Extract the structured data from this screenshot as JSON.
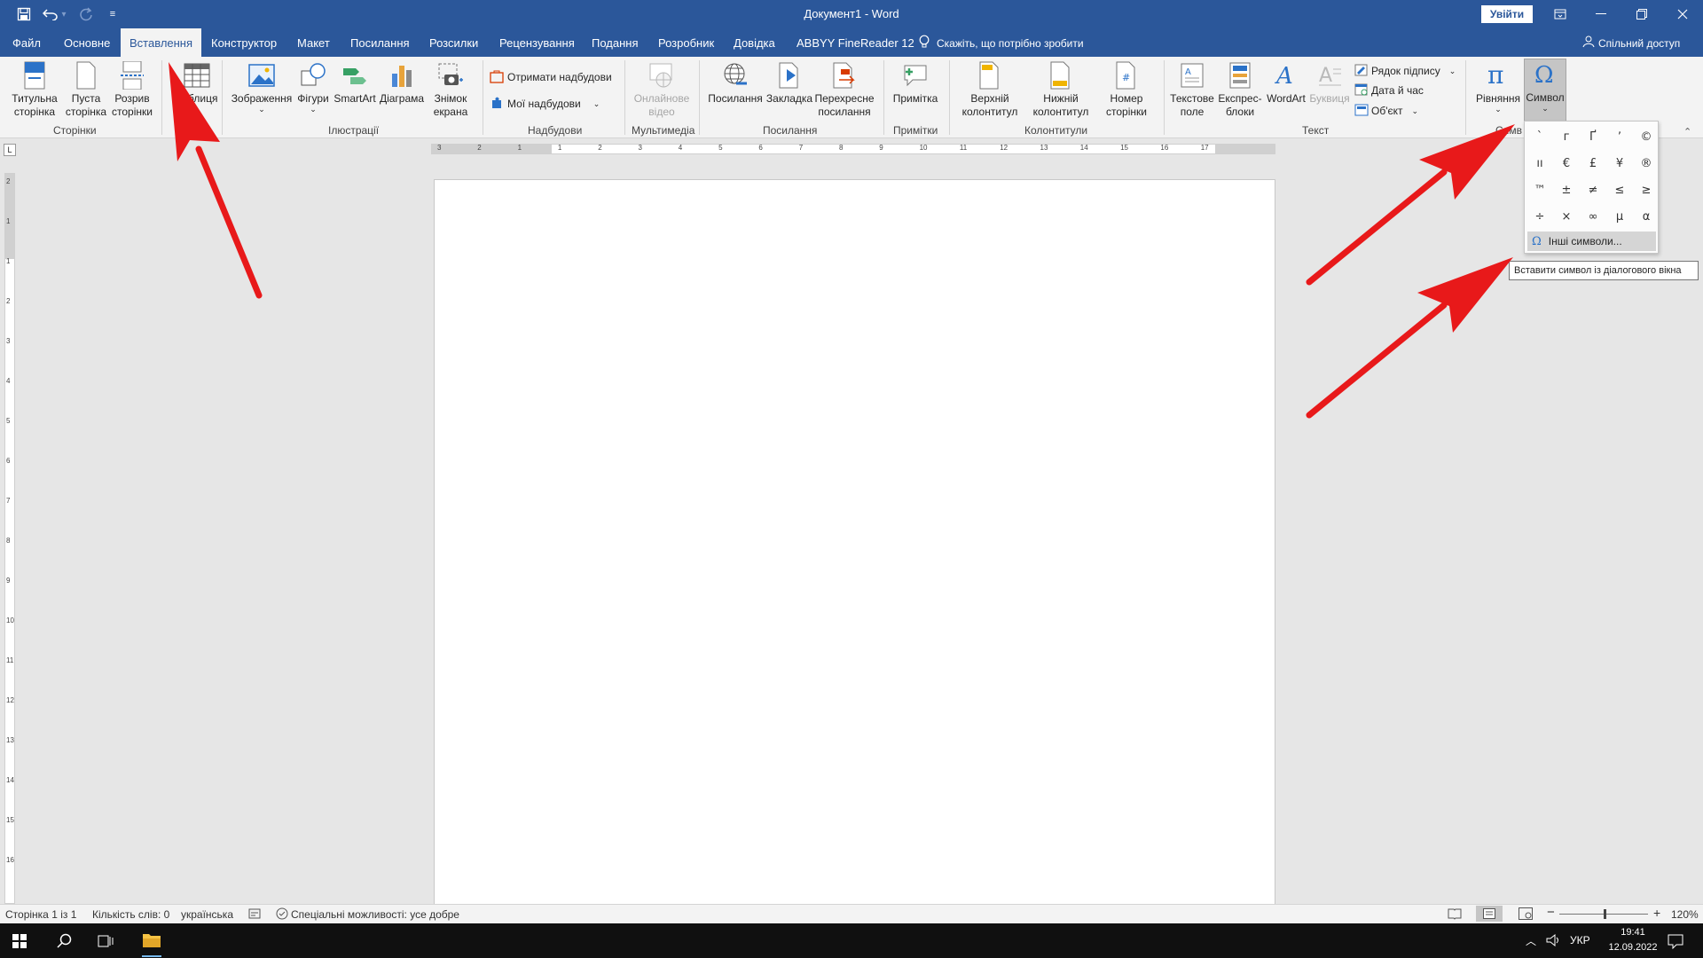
{
  "app": {
    "doc_title": "Документ1 - Word",
    "signin_label": "Увійти",
    "share_label": "Спільний доступ"
  },
  "qat": {
    "icons": [
      "save-icon",
      "undo-icon",
      "redo-icon",
      "customize-icon"
    ]
  },
  "tabs": [
    "Файл",
    "Основне",
    "Вставлення",
    "Конструктор",
    "Макет",
    "Посилання",
    "Розсилки",
    "Рецензування",
    "Подання",
    "Розробник",
    "Довідка",
    "ABBYY FineReader 12"
  ],
  "active_tab": "Вставлення",
  "tell_me": "Скажіть, що потрібно зробити",
  "ribbon": {
    "pages": {
      "label": "Сторінки",
      "cover": "Титульна сторінка",
      "blank": "Пуста сторінка",
      "break": "Розрив сторінки"
    },
    "table": {
      "label": "Таблиця"
    },
    "illustrations": {
      "label": "Ілюстрації",
      "pictures": "Зображення",
      "shapes": "Фігури",
      "smartart": "SmartArt",
      "chart": "Діаграма",
      "screenshot": "Знімок екрана"
    },
    "addins": {
      "label": "Надбудови",
      "get": "Отримати надбудови",
      "my": "Мої надбудови"
    },
    "media": {
      "label": "Мультимедіа",
      "online_video": "Онлайнове відео"
    },
    "links": {
      "label": "Посилання",
      "link": "Посилання",
      "bookmark": "Закладка",
      "crossref": "Перехресне посилання"
    },
    "comments": {
      "label": "Примітки",
      "comment": "Примітка"
    },
    "header_footer": {
      "label": "Колонтитули",
      "header": "Верхній колонтитул",
      "footer": "Нижній колонтитул",
      "page_number": "Номер сторінки"
    },
    "text": {
      "label": "Текст",
      "textbox": "Текстове поле",
      "quickparts": "Експрес-блоки",
      "wordart": "WordArt",
      "dropcap": "Буквиця",
      "signature": "Рядок підпису",
      "datetime": "Дата й час",
      "object": "Об'єкт"
    },
    "symbols": {
      "label": "Символи",
      "equation": "Рівняння",
      "symbol": "Символ"
    }
  },
  "symbol_dropdown": {
    "symbols": [
      "`",
      "г",
      "Ґ",
      "ʼ",
      "©",
      "ıı",
      "€",
      "£",
      "¥",
      "®",
      "™",
      "±",
      "≠",
      "≤",
      "≥",
      "÷",
      "×",
      "∞",
      "µ",
      "α"
    ],
    "more_label": "Інші символи...",
    "tooltip": "Вставити символ із діалогового вікна"
  },
  "ruler": {
    "h_numbers": [
      "3",
      "2",
      "1",
      "1",
      "2",
      "3",
      "4",
      "5",
      "6",
      "7",
      "8",
      "9",
      "10",
      "11",
      "12",
      "13",
      "14",
      "15",
      "16",
      "17"
    ],
    "v_numbers": [
      "2",
      "1",
      "1",
      "2",
      "3",
      "4",
      "5",
      "6",
      "7",
      "8",
      "9",
      "10",
      "11",
      "12",
      "13",
      "14",
      "15",
      "16"
    ]
  },
  "status": {
    "page": "Сторінка 1 із 1",
    "words": "Кількість слів: 0",
    "language": "українська",
    "accessibility": "Спеціальні можливості: усе добре",
    "zoom": "120%"
  },
  "taskbar": {
    "lang": "УКР",
    "time": "19:41",
    "date": "12.09.2022"
  },
  "colors": {
    "brand": "#2b579a",
    "arrow": "#e8191a"
  }
}
